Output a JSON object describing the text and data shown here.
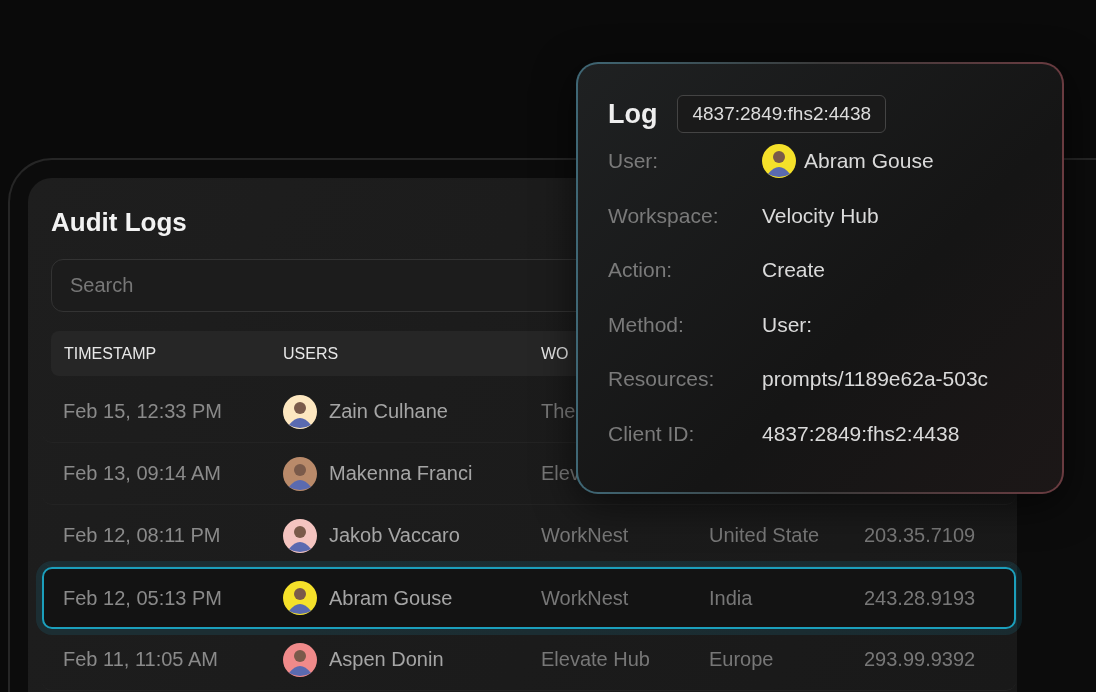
{
  "panel": {
    "title": "Audit Logs",
    "search": {
      "placeholder": "Search"
    }
  },
  "table": {
    "columns": [
      "TIMESTAMP",
      "USERS",
      "WO"
    ],
    "rows": [
      {
        "timestamp": "Feb 15, 12:33 PM",
        "user": {
          "name": "Zain Culhane",
          "color": "#fde7c0"
        },
        "column_3": "The",
        "selected": false
      },
      {
        "timestamp": "Feb 13, 09:14 AM",
        "user": {
          "name": "Makenna Franci",
          "color": "#b98a6a"
        },
        "column_3": "Elev",
        "selected": false
      },
      {
        "timestamp": "Feb 12, 08:11 PM",
        "user": {
          "name": "Jakob Vaccaro",
          "color": "#f4c4c0"
        },
        "column_3": "WorkNest",
        "column_4": "United State",
        "column_5": "203.35.7109",
        "selected": false
      },
      {
        "timestamp": "Feb 12, 05:13 PM",
        "user": {
          "name": "Abram Gouse",
          "color": "#f5e12a"
        },
        "column_3": "WorkNest",
        "column_4": "India",
        "column_5": "243.28.9193",
        "selected": true
      },
      {
        "timestamp": "Feb 11, 11:05 AM",
        "user": {
          "name": "Aspen Donin",
          "color": "#f08a8a"
        },
        "column_3": "Elevate Hub",
        "column_4": "Europe",
        "column_5": "293.99.9392",
        "selected": false
      }
    ]
  },
  "log_card": {
    "title": "Log",
    "id": "4837:2849:fhs2:4438",
    "fields": [
      {
        "kind": "user",
        "label": "User:",
        "value": "Abram Gouse",
        "color": "#f5e12a"
      },
      {
        "kind": "text",
        "label": "Workspace:",
        "value": "Velocity Hub"
      },
      {
        "kind": "text",
        "label": "Action:",
        "value": "Create"
      },
      {
        "kind": "text",
        "label": "Method:",
        "value": "User:"
      },
      {
        "kind": "text",
        "label": "Resources:",
        "value": "prompts/1189e62a-503c"
      },
      {
        "kind": "text",
        "label": "Client ID:",
        "value": "4837:2849:fhs2:4438"
      }
    ]
  }
}
